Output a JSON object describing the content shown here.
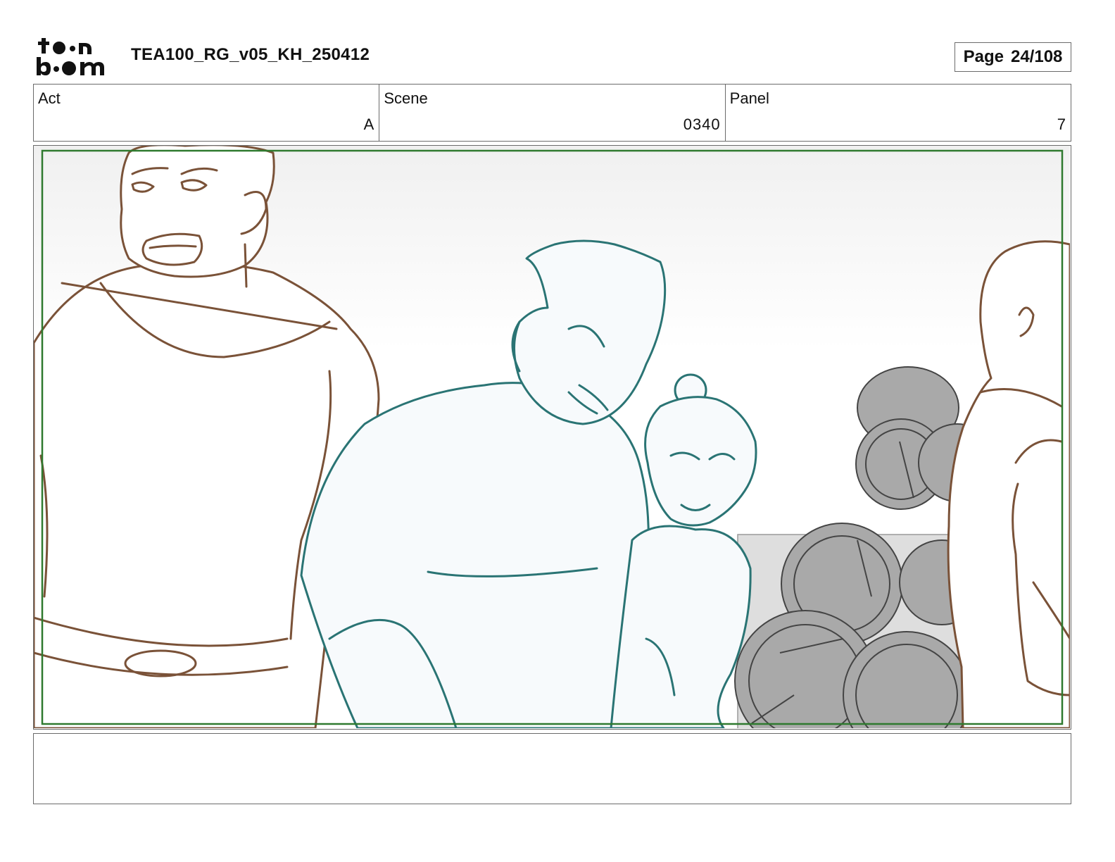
{
  "header": {
    "logo_text": "toonboom",
    "doc_title": "TEA100_RG_v05_KH_250412",
    "page_label": "Page",
    "page_number": "24/108"
  },
  "info": {
    "act": {
      "label": "Act",
      "value": "A"
    },
    "scene": {
      "label": "Scene",
      "value": "0340"
    },
    "panel": {
      "label": "Panel",
      "value": "7"
    }
  },
  "colors": {
    "brown_sketch": "#7a5238",
    "teal_sketch": "#2a7474",
    "safe_frame": "#2f7a2f",
    "barrels_gray": "#a9a9a9"
  },
  "notes": {
    "text": ""
  }
}
